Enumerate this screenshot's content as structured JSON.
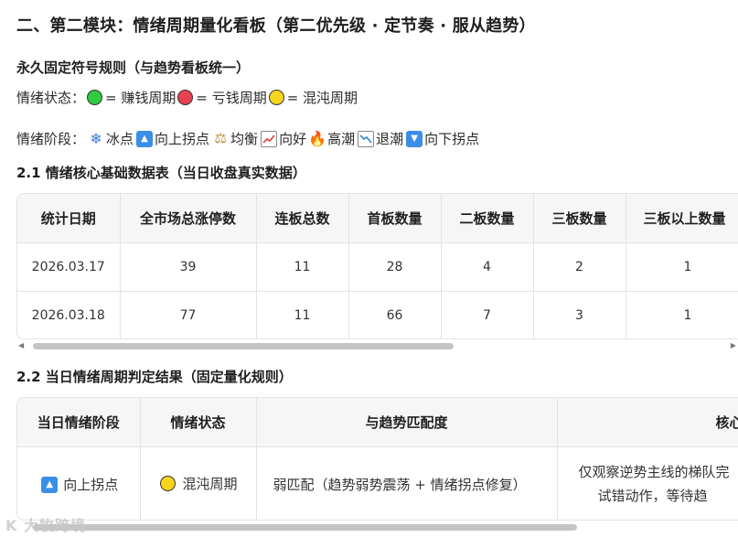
{
  "section_title": "二、第二模块：情绪周期量化看板（第二优先级 · 定节奏 · 服从趋势）",
  "rules_title": "永久固定符号规则（与趋势看板统一）",
  "state_rule": {
    "label": "情绪状态：",
    "items": [
      {
        "color": "#2ecc40",
        "text": "= 赚钱周期"
      },
      {
        "color": "#e8414f",
        "text": "= 亏钱周期"
      },
      {
        "color": "#f7d51d",
        "text": "= 混沌周期"
      }
    ]
  },
  "stage_rule": {
    "label": "情绪阶段：",
    "items": [
      {
        "icon": "snowflake-icon",
        "text": "冰点"
      },
      {
        "icon": "up-triangle-icon",
        "text": "向上拐点"
      },
      {
        "icon": "scale-icon",
        "text": "均衡"
      },
      {
        "icon": "chart-up-icon",
        "text": "向好"
      },
      {
        "icon": "fire-icon",
        "text": "高潮"
      },
      {
        "icon": "chart-down-icon",
        "text": "退潮"
      },
      {
        "icon": "down-triangle-icon",
        "text": "向下拐点"
      }
    ]
  },
  "table1": {
    "title": "2.1 情绪核心基础数据表（当日收盘真实数据）",
    "headers": [
      "统计日期",
      "全市场总涨停数",
      "连板总数",
      "首板数量",
      "二板数量",
      "三板数量",
      "三板以上数量"
    ],
    "rows": [
      [
        "2026.03.17",
        "39",
        "11",
        "28",
        "4",
        "2",
        "1"
      ],
      [
        "2026.03.18",
        "77",
        "11",
        "66",
        "7",
        "3",
        "1"
      ]
    ]
  },
  "table2": {
    "title": "2.2 当日情绪周期判定结果（固定量化规则）",
    "headers": [
      "当日情绪阶段",
      "情绪状态",
      "与趋势匹配度",
      "核心"
    ],
    "row": {
      "stage": "向上拐点",
      "state": "混沌周期",
      "match": "弱匹配（趋势弱势震荡 + 情绪拐点修复）",
      "core_line1": "仅观察逆势主线的梯队完",
      "core_line2": "试错动作，等待趋"
    }
  },
  "watermark": "K 大牧跨境"
}
